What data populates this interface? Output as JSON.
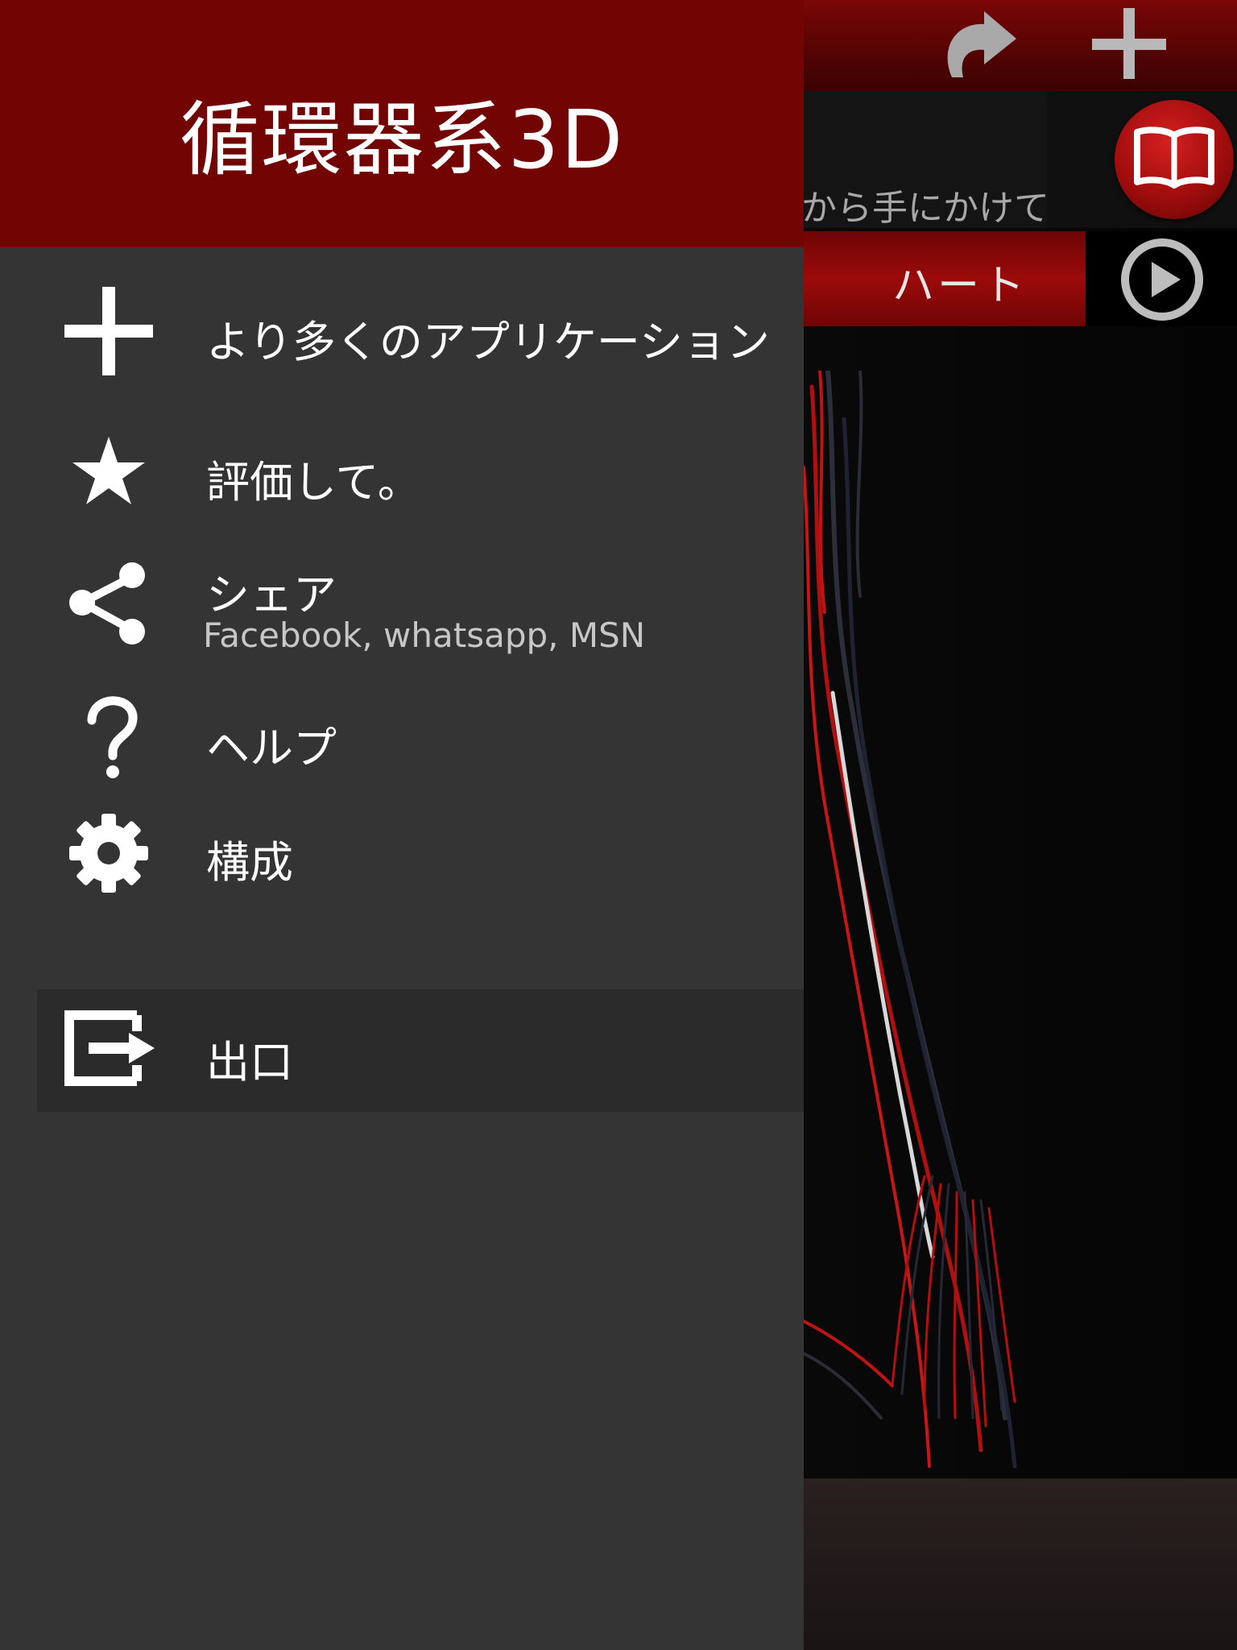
{
  "app": {
    "info_text": "から手にかけて",
    "tab_label": "ハート",
    "icons": {
      "redo": "redo-icon",
      "add": "plus-icon",
      "book": "book-icon",
      "play": "play-icon"
    }
  },
  "drawer": {
    "title": "循環器系3D",
    "items": [
      {
        "label": "より多くのアプリケーション",
        "icon": "plus-icon"
      },
      {
        "label": "評価して。",
        "icon": "star-icon"
      },
      {
        "label": "シェア",
        "sublabel": "Facebook, whatsapp, MSN",
        "icon": "share-icon"
      },
      {
        "label": "ヘルプ",
        "icon": "help-icon"
      },
      {
        "label": "構成",
        "icon": "gear-icon"
      },
      {
        "label": "出口",
        "icon": "exit-icon"
      }
    ]
  },
  "colors": {
    "header_red": "#730404",
    "drawer_bg": "#353434",
    "exit_bg": "#2b2b2b",
    "accent_red": "#9c0a0a"
  }
}
